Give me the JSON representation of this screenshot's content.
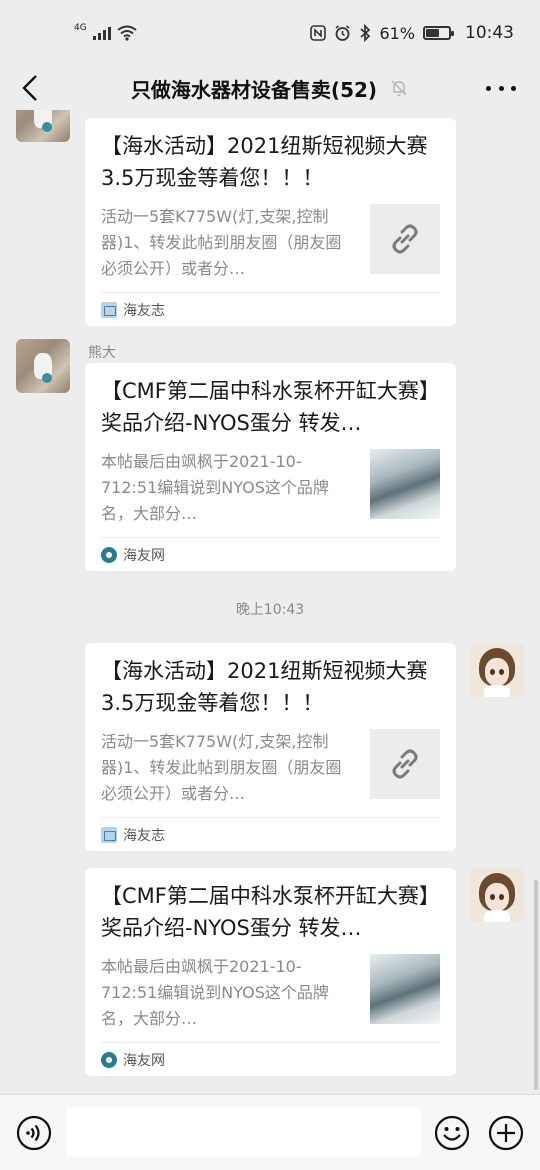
{
  "status_bar": {
    "network": "4G",
    "battery_text": "61%",
    "battery_level": 0.61,
    "time": "10:43"
  },
  "header": {
    "title": "只做海水器材设备售卖(52)"
  },
  "messages": [
    {
      "direction": "incoming",
      "sender": "",
      "title": "【海水活动】2021纽斯短视频大赛 3.5万现金等着您！！！",
      "description": "活动一5套K775W(灯,支架,控制器)1、转发此帖到朋友圈（朋友圈必须公开）或者分…",
      "thumb": "link-icon",
      "source": "海友志"
    },
    {
      "direction": "incoming",
      "sender": "熊大",
      "title": "【CMF第二届中科水泵杯开缸大赛】奖品介绍-NYOS蛋分 转发…",
      "description": "本帖最后由飒枫于2021-10-712:51编辑说到NYOS这个品牌名，大部分…",
      "thumb": "image",
      "source": "海友网"
    },
    {
      "direction": "outgoing",
      "title": "【海水活动】2021纽斯短视频大赛 3.5万现金等着您！！！",
      "description": "活动一5套K775W(灯,支架,控制器)1、转发此帖到朋友圈（朋友圈必须公开）或者分…",
      "thumb": "link-icon",
      "source": "海友志"
    },
    {
      "direction": "outgoing",
      "title": "【CMF第二届中科水泵杯开缸大赛】奖品介绍-NYOS蛋分 转发…",
      "description": "本帖最后由飒枫于2021-10-712:51编辑说到NYOS这个品牌名，大部分…",
      "thumb": "image",
      "source": "海友网"
    }
  ],
  "timestamp": "晚上10:43",
  "input_bar": {
    "placeholder": "",
    "icons": [
      "voice-icon",
      "emoji-icon",
      "plus-icon"
    ]
  },
  "colors": {
    "background": "#ededed",
    "card": "#ffffff",
    "muted_text": "#8a8a8a"
  }
}
